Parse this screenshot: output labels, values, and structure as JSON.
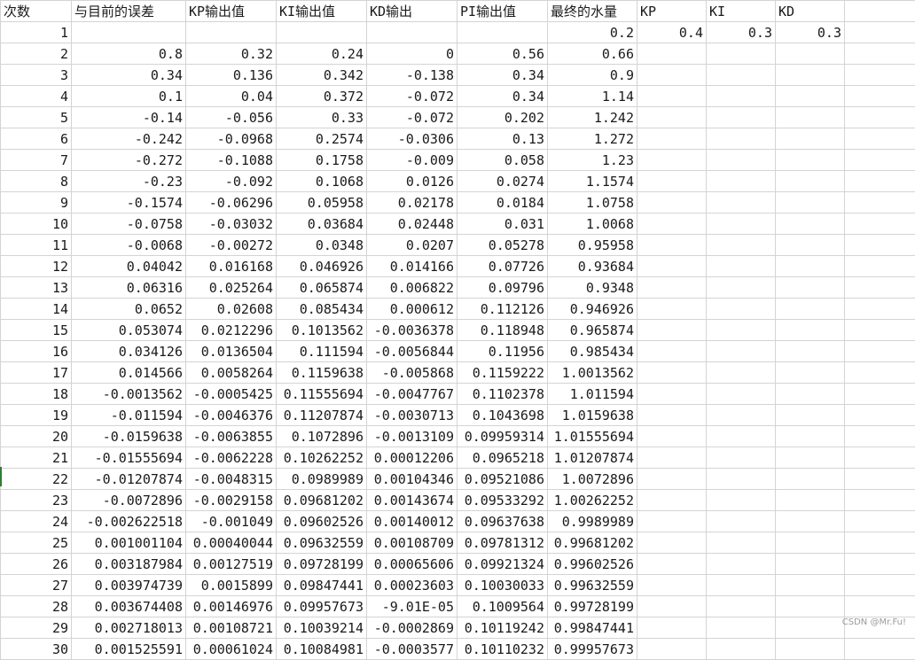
{
  "headers": [
    "次数",
    "与目前的误差",
    "KP输出值",
    "KI输出值",
    "KD输出",
    "PI输出值",
    "最终的水量"
  ],
  "params": {
    "labels": [
      "KP",
      "KI",
      "KD"
    ],
    "values": [
      "0.4",
      "0.3",
      "0.3"
    ]
  },
  "rows": [
    [
      "1",
      "",
      "",
      "",
      "",
      "",
      "0.2"
    ],
    [
      "2",
      "0.8",
      "0.32",
      "0.24",
      "0",
      "0.56",
      "0.66"
    ],
    [
      "3",
      "0.34",
      "0.136",
      "0.342",
      "-0.138",
      "0.34",
      "0.9"
    ],
    [
      "4",
      "0.1",
      "0.04",
      "0.372",
      "-0.072",
      "0.34",
      "1.14"
    ],
    [
      "5",
      "-0.14",
      "-0.056",
      "0.33",
      "-0.072",
      "0.202",
      "1.242"
    ],
    [
      "6",
      "-0.242",
      "-0.0968",
      "0.2574",
      "-0.0306",
      "0.13",
      "1.272"
    ],
    [
      "7",
      "-0.272",
      "-0.1088",
      "0.1758",
      "-0.009",
      "0.058",
      "1.23"
    ],
    [
      "8",
      "-0.23",
      "-0.092",
      "0.1068",
      "0.0126",
      "0.0274",
      "1.1574"
    ],
    [
      "9",
      "-0.1574",
      "-0.06296",
      "0.05958",
      "0.02178",
      "0.0184",
      "1.0758"
    ],
    [
      "10",
      "-0.0758",
      "-0.03032",
      "0.03684",
      "0.02448",
      "0.031",
      "1.0068"
    ],
    [
      "11",
      "-0.0068",
      "-0.00272",
      "0.0348",
      "0.0207",
      "0.05278",
      "0.95958"
    ],
    [
      "12",
      "0.04042",
      "0.016168",
      "0.046926",
      "0.014166",
      "0.07726",
      "0.93684"
    ],
    [
      "13",
      "0.06316",
      "0.025264",
      "0.065874",
      "0.006822",
      "0.09796",
      "0.9348"
    ],
    [
      "14",
      "0.0652",
      "0.02608",
      "0.085434",
      "0.000612",
      "0.112126",
      "0.946926"
    ],
    [
      "15",
      "0.053074",
      "0.0212296",
      "0.1013562",
      "-0.0036378",
      "0.118948",
      "0.965874"
    ],
    [
      "16",
      "0.034126",
      "0.0136504",
      "0.111594",
      "-0.0056844",
      "0.11956",
      "0.985434"
    ],
    [
      "17",
      "0.014566",
      "0.0058264",
      "0.1159638",
      "-0.005868",
      "0.1159222",
      "1.0013562"
    ],
    [
      "18",
      "-0.0013562",
      "-0.0005425",
      "0.11555694",
      "-0.0047767",
      "0.1102378",
      "1.011594"
    ],
    [
      "19",
      "-0.011594",
      "-0.0046376",
      "0.11207874",
      "-0.0030713",
      "0.1043698",
      "1.0159638"
    ],
    [
      "20",
      "-0.0159638",
      "-0.0063855",
      "0.1072896",
      "-0.0013109",
      "0.09959314",
      "1.01555694"
    ],
    [
      "21",
      "-0.01555694",
      "-0.0062228",
      "0.10262252",
      "0.00012206",
      "0.0965218",
      "1.01207874"
    ],
    [
      "22",
      "-0.01207874",
      "-0.0048315",
      "0.0989989",
      "0.00104346",
      "0.09521086",
      "1.0072896"
    ],
    [
      "23",
      "-0.0072896",
      "-0.0029158",
      "0.09681202",
      "0.00143674",
      "0.09533292",
      "1.00262252"
    ],
    [
      "24",
      "-0.002622518",
      "-0.001049",
      "0.09602526",
      "0.00140012",
      "0.09637638",
      "0.9989989"
    ],
    [
      "25",
      "0.001001104",
      "0.00040044",
      "0.09632559",
      "0.00108709",
      "0.09781312",
      "0.99681202"
    ],
    [
      "26",
      "0.003187984",
      "0.00127519",
      "0.09728199",
      "0.00065606",
      "0.09921324",
      "0.99602526"
    ],
    [
      "27",
      "0.003974739",
      "0.0015899",
      "0.09847441",
      "0.00023603",
      "0.10030033",
      "0.99632559"
    ],
    [
      "28",
      "0.003674408",
      "0.00146976",
      "0.09957673",
      "-9.01E-05",
      "0.1009564",
      "0.99728199"
    ],
    [
      "29",
      "0.002718013",
      "0.00108721",
      "0.10039214",
      "-0.0002869",
      "0.10119242",
      "0.99847441"
    ],
    [
      "30",
      "0.001525591",
      "0.00061024",
      "0.10084981",
      "-0.0003577",
      "0.10110232",
      "0.99957673"
    ]
  ],
  "watermark": "CSDN @Mr.Fu!"
}
